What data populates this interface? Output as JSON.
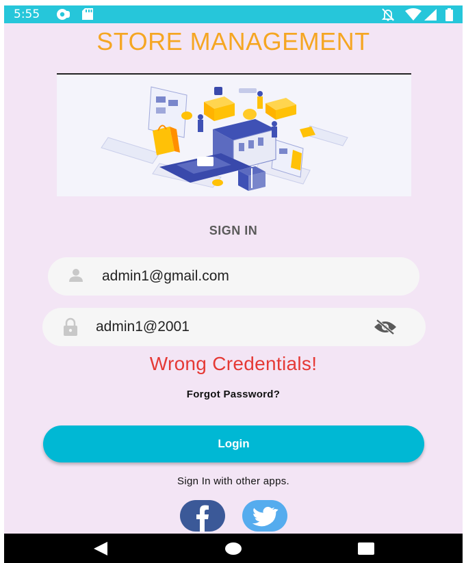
{
  "status_bar": {
    "time": "5:55",
    "icons": [
      "app-notification-icon",
      "sd-card-icon",
      "notifications-off-icon",
      "wifi-icon",
      "signal-icon",
      "battery-icon"
    ]
  },
  "header": {
    "title": "STORE MANAGEMENT"
  },
  "hero": {
    "icon": "store-illustration"
  },
  "form": {
    "heading": "SIGN IN",
    "email": {
      "value": "admin1@gmail.com",
      "icon": "person-icon"
    },
    "password": {
      "value": "admin1@2001",
      "icon": "lock-icon",
      "toggle_icon": "visibility-off-icon"
    },
    "error": "Wrong Credentials!",
    "forgot_password": "Forgot Password?",
    "login_label": "Login",
    "other_apps": "Sign In with other apps."
  },
  "social": {
    "facebook_label": "f",
    "twitter_icon": "twitter-bird-icon"
  },
  "colors": {
    "status_bar": "#26c6da",
    "background": "#f3e5f5",
    "title": "#f5a623",
    "error": "#e53935",
    "login_button": "#00b8d4",
    "facebook": "#3b5998",
    "twitter": "#55acee"
  },
  "nav_bar": {
    "icons": [
      "back-icon",
      "home-icon",
      "recents-icon"
    ]
  }
}
